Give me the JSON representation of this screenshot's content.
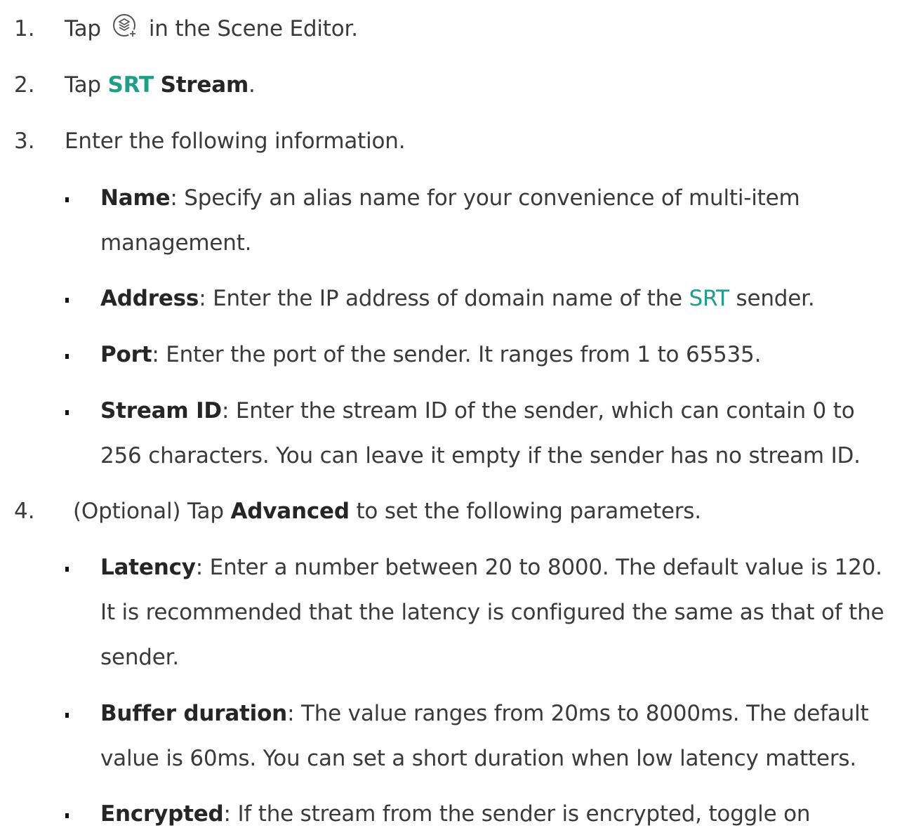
{
  "steps": [
    {
      "num": "1.",
      "pre": "Tap",
      "icon": "add-source-icon",
      "post": "in the Scene Editor."
    },
    {
      "num": "2.",
      "pre": "Tap ",
      "green": "SRT",
      "bold": "Stream",
      "post": "."
    },
    {
      "num": "3.",
      "text": "Enter the following information."
    },
    {
      "num": "4.",
      "pre": "(Optional) Tap ",
      "bold": "Advanced",
      "post": " to set the following parameters."
    }
  ],
  "info_items": [
    {
      "term": "Name",
      "lines": [
        ": Specify an alias name for your convenience of multi-item",
        "management."
      ]
    },
    {
      "term": "Address",
      "pre": ": Enter the IP address of domain name of the ",
      "green": "SRT",
      "post": " sender."
    },
    {
      "term": "Port",
      "lines": [
        ": Enter the port of the sender. It ranges from 1 to 65535."
      ]
    },
    {
      "term": "Stream ID",
      "lines": [
        ": Enter the stream ID of the sender, which can contain 0 to",
        "256 characters. You can leave it empty if the sender has no stream ID."
      ]
    }
  ],
  "advanced_items": [
    {
      "term": "Latency",
      "lines": [
        ": Enter a number between 20 to 8000. The default value is 120.",
        "It is recommended that the latency is configured the same as that of the",
        "sender."
      ]
    },
    {
      "term": "Buffer duration",
      "lines": [
        ": The value ranges from 20ms to 8000ms. The default",
        "value is 60ms. You can set a short duration when low latency matters."
      ]
    },
    {
      "term": "Encrypted",
      "lines": [
        ": If the stream from the sender is encrypted, toggle on"
      ]
    }
  ],
  "colors": {
    "accent": "#1f9e86",
    "text": "#3a3a3a"
  }
}
